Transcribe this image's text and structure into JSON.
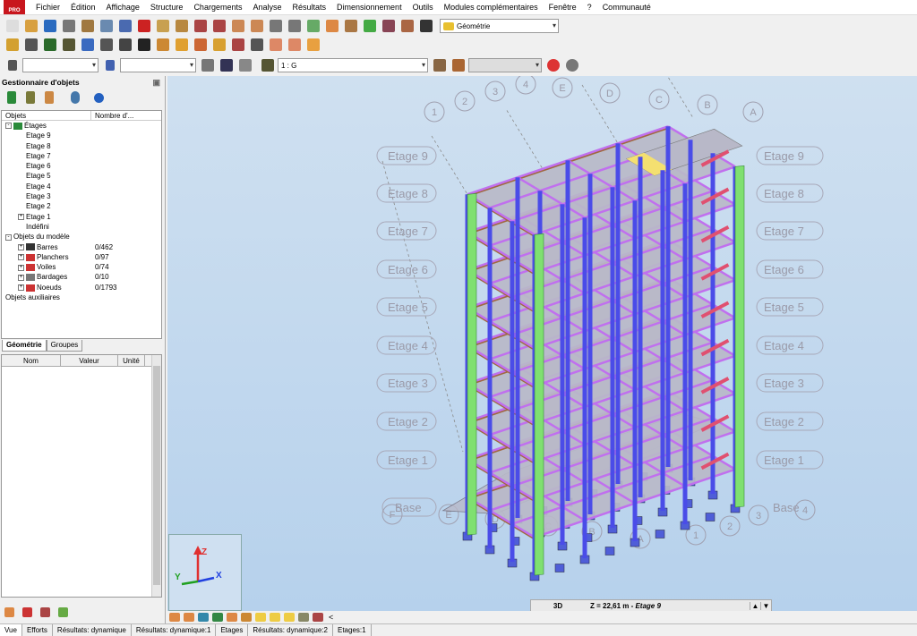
{
  "menu": {
    "items": [
      "Fichier",
      "Édition",
      "Affichage",
      "Structure",
      "Chargements",
      "Analyse",
      "Résultats",
      "Dimensionnement",
      "Outils",
      "Modules complémentaires",
      "Fenêtre",
      "?",
      "Communauté"
    ]
  },
  "logo_text": "PRO",
  "toolbar": {
    "layout_combo": "Géométrie",
    "story_combo": "1 : G"
  },
  "colors": {
    "viewport_top": "#cfe0f0",
    "column": "#4a4ce8",
    "beam": "#c070ee",
    "shear_wall": "#7fe070",
    "slab": "#b8b8c8",
    "slab_edge": "#a06840",
    "stair": "#e05070",
    "grid": "#8a8a8a"
  },
  "left_panel": {
    "title": "Gestionnaire d'objets",
    "tree_header": {
      "col1": "Objets",
      "col2": "Nombre d'..."
    },
    "tree": [
      {
        "label": "Étages",
        "count": "",
        "level": 0,
        "exp": "-",
        "icon": "storey-icon"
      },
      {
        "label": "Etage 9",
        "count": "",
        "level": 1,
        "exp": "",
        "icon": ""
      },
      {
        "label": "Etage 8",
        "count": "",
        "level": 1,
        "exp": "",
        "icon": ""
      },
      {
        "label": "Etage 7",
        "count": "",
        "level": 1,
        "exp": "",
        "icon": ""
      },
      {
        "label": "Etage 6",
        "count": "",
        "level": 1,
        "exp": "",
        "icon": ""
      },
      {
        "label": "Etage 5",
        "count": "",
        "level": 1,
        "exp": "",
        "icon": ""
      },
      {
        "label": "Etage 4",
        "count": "",
        "level": 1,
        "exp": "",
        "icon": ""
      },
      {
        "label": "Etage 3",
        "count": "",
        "level": 1,
        "exp": "",
        "icon": ""
      },
      {
        "label": "Etage 2",
        "count": "",
        "level": 1,
        "exp": "",
        "icon": ""
      },
      {
        "label": "Etage 1",
        "count": "",
        "level": 1,
        "exp": "+",
        "icon": ""
      },
      {
        "label": "Indéfini",
        "count": "",
        "level": 1,
        "exp": "",
        "icon": ""
      },
      {
        "label": "Objets du modèle",
        "count": "",
        "level": 0,
        "exp": "-",
        "icon": ""
      },
      {
        "label": "Barres",
        "count": "0/462",
        "level": 1,
        "exp": "+",
        "icon": "bar-icon"
      },
      {
        "label": "Planchers",
        "count": "0/97",
        "level": 1,
        "exp": "+",
        "icon": "slab-icon"
      },
      {
        "label": "Voiles",
        "count": "0/74",
        "level": 1,
        "exp": "+",
        "icon": "wall-icon"
      },
      {
        "label": "Bardages",
        "count": "0/10",
        "level": 1,
        "exp": "+",
        "icon": "cladding-icon"
      },
      {
        "label": "Noeuds",
        "count": "0/1793",
        "level": 1,
        "exp": "+",
        "icon": "node-icon"
      },
      {
        "label": "Objets auxiliaires",
        "count": "",
        "level": 0,
        "exp": "",
        "icon": ""
      }
    ],
    "tabs": [
      "Géométrie",
      "Groupes"
    ],
    "prop_header": [
      "Nom",
      "Valeur",
      "Unité"
    ]
  },
  "viewport": {
    "view_label": "3D",
    "z_label": "Z = 22,61 m - ",
    "z_story": "Etage 9",
    "axes": {
      "x": "X",
      "y": "Y",
      "z": "Z"
    },
    "story_labels": [
      "Etage 9",
      "Etage 8",
      "Etage 7",
      "Etage 6",
      "Etage 5",
      "Etage 4",
      "Etage 3",
      "Etage 2",
      "Etage 1",
      "Base"
    ],
    "grid_top": [
      "1",
      "2",
      "3",
      "4",
      "E",
      "D",
      "C",
      "B",
      "A"
    ],
    "grid_bottom": [
      "F",
      "E",
      "D",
      "C",
      "B",
      "A",
      "1",
      "2",
      "3",
      "4"
    ]
  },
  "status_tabs": [
    "Vue",
    "Efforts",
    "Résultats: dynamique",
    "Résultats: dynamique:1",
    "Etages",
    "Résultats: dynamique:2",
    "Etages:1"
  ]
}
